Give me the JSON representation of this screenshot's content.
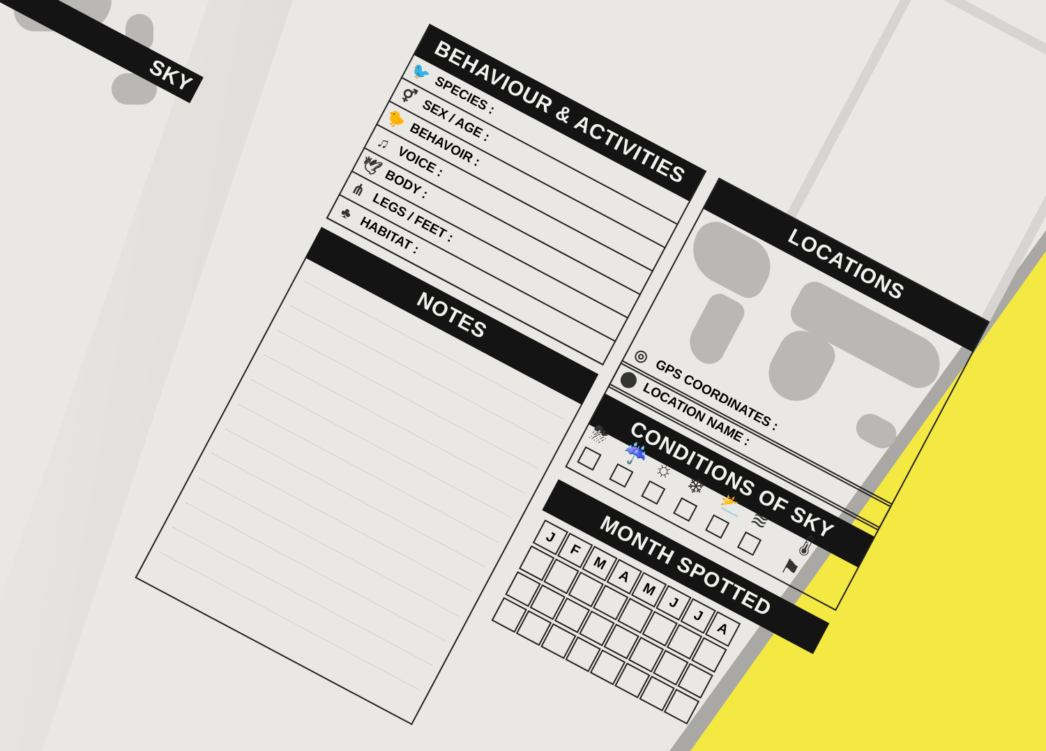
{
  "sections": {
    "behaviour_title": "BEHAVIOUR & ACTIVITIES",
    "notes_title": "NOTES",
    "locations_title": "LOCATIONS",
    "conditions_title": "CONDITIONS OF SKY",
    "month_title": "MONTH SPOTTED",
    "left_page_title_fragment": "SKY"
  },
  "behaviour_fields": [
    {
      "label": "SPECIES :",
      "icon": "birds-icon"
    },
    {
      "label": "SEX / AGE :",
      "icon": "gender-icon"
    },
    {
      "label": "BEHAVOIR :",
      "icon": "bird-standing-icon"
    },
    {
      "label": "VOICE :",
      "icon": "music-note-icon"
    },
    {
      "label": "BODY :",
      "icon": "bird-flying-icon"
    },
    {
      "label": "LEGS / FEET :",
      "icon": "bird-legs-icon"
    },
    {
      "label": "HABITAT :",
      "icon": "trees-icon"
    }
  ],
  "location_fields": [
    {
      "label": "GPS COORDINATES :",
      "icon": "compass-icon"
    },
    {
      "label": "LOCATION NAME :",
      "icon": "map-pin-icon"
    }
  ],
  "weather_icons": [
    "thunderstorm-icon",
    "rain-cloud-icon",
    "sun-icon",
    "snowflake-icon",
    "partly-cloudy-icon",
    "wind-icon"
  ],
  "extra_icons": [
    "thermometer-icon",
    "windsock-icon"
  ],
  "months": [
    "J",
    "F",
    "M",
    "A",
    "M",
    "J",
    "J",
    "A"
  ],
  "colors": {
    "background": "#f4e842",
    "paper": "#e9e8e4",
    "bar": "#141414",
    "map": "#b9b8b4"
  }
}
